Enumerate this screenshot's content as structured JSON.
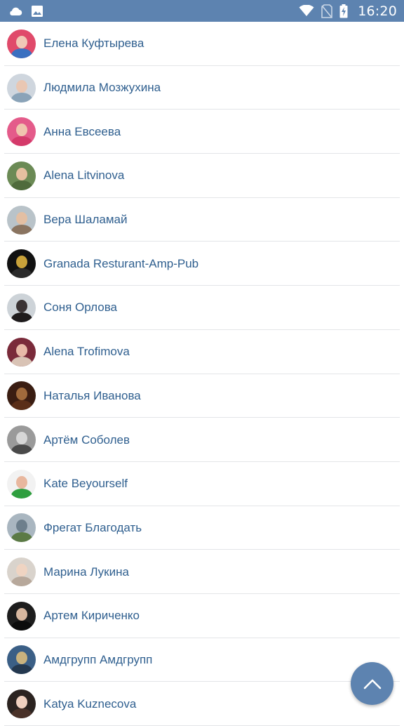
{
  "status_bar": {
    "time": "16:20",
    "left_icons": [
      "cloud-icon",
      "image-icon"
    ],
    "right_icons": [
      "wifi-icon",
      "no-sim-icon",
      "battery-charging-icon"
    ],
    "background": "#5d83b0"
  },
  "friends": [
    {
      "name": "Елена Куфтырева",
      "avatar": {
        "bg": "#e04a6a",
        "face": "#f1c8b6",
        "body": "#3a6fc0"
      }
    },
    {
      "name": "Людмила Мозжухина",
      "avatar": {
        "bg": "#cfd6de",
        "face": "#e9c7b3",
        "body": "#8aa3b8"
      }
    },
    {
      "name": "Анна Евсеева",
      "avatar": {
        "bg": "#e45b8a",
        "face": "#f0c4ae",
        "body": "#d43a6a"
      }
    },
    {
      "name": "Alena Litvinova",
      "avatar": {
        "bg": "#6b8a55",
        "face": "#e5c0a0",
        "body": "#4f6b3c"
      }
    },
    {
      "name": "Вера Шаламай",
      "avatar": {
        "bg": "#b9c3c9",
        "face": "#e3bfa3",
        "body": "#8a7460"
      }
    },
    {
      "name": "Granada Resturant-Amp-Pub",
      "avatar": {
        "bg": "#111111",
        "face": "#c9a23a",
        "body": "#2a2a2a"
      }
    },
    {
      "name": "Соня Орлова",
      "avatar": {
        "bg": "#cdd3d8",
        "face": "#3a3334",
        "body": "#1e1b1c"
      }
    },
    {
      "name": "Alena Trofimova",
      "avatar": {
        "bg": "#7a2a3a",
        "face": "#e8b9a8",
        "body": "#d9c3b5"
      }
    },
    {
      "name": "Наталья Иванова",
      "avatar": {
        "bg": "#3a1d12",
        "face": "#a06a3c",
        "body": "#5a2e18"
      }
    },
    {
      "name": "Артём Соболев",
      "avatar": {
        "bg": "#9a9a9a",
        "face": "#d6d6d6",
        "body": "#4a4a4a"
      }
    },
    {
      "name": "Kate Beyourself",
      "avatar": {
        "bg": "#f2f2f2",
        "face": "#e8b79e",
        "body": "#2f9e3f"
      }
    },
    {
      "name": "Фрегат Благодать",
      "avatar": {
        "bg": "#a9b6c0",
        "face": "#6d7f8c",
        "body": "#5b7a45"
      }
    },
    {
      "name": "Марина Лукина",
      "avatar": {
        "bg": "#d9d3cc",
        "face": "#efd4c2",
        "body": "#b7a89b"
      }
    },
    {
      "name": "Артем Кириченко",
      "avatar": {
        "bg": "#1d1d1d",
        "face": "#d7b79f",
        "body": "#0c0c0c"
      }
    },
    {
      "name": "Амдгрупп Амдгрупп",
      "avatar": {
        "bg": "#3b5f86",
        "face": "#c9b27e",
        "body": "#24384f"
      }
    },
    {
      "name": "Katya Kuznecova",
      "avatar": {
        "bg": "#2b2320",
        "face": "#efd0bf",
        "body": "#4a3229"
      }
    }
  ],
  "fab": {
    "icon": "chevron-up-icon",
    "color": "#5d83b0"
  },
  "colors": {
    "name_text": "#2f5f8f",
    "divider": "#e3e5e8"
  }
}
